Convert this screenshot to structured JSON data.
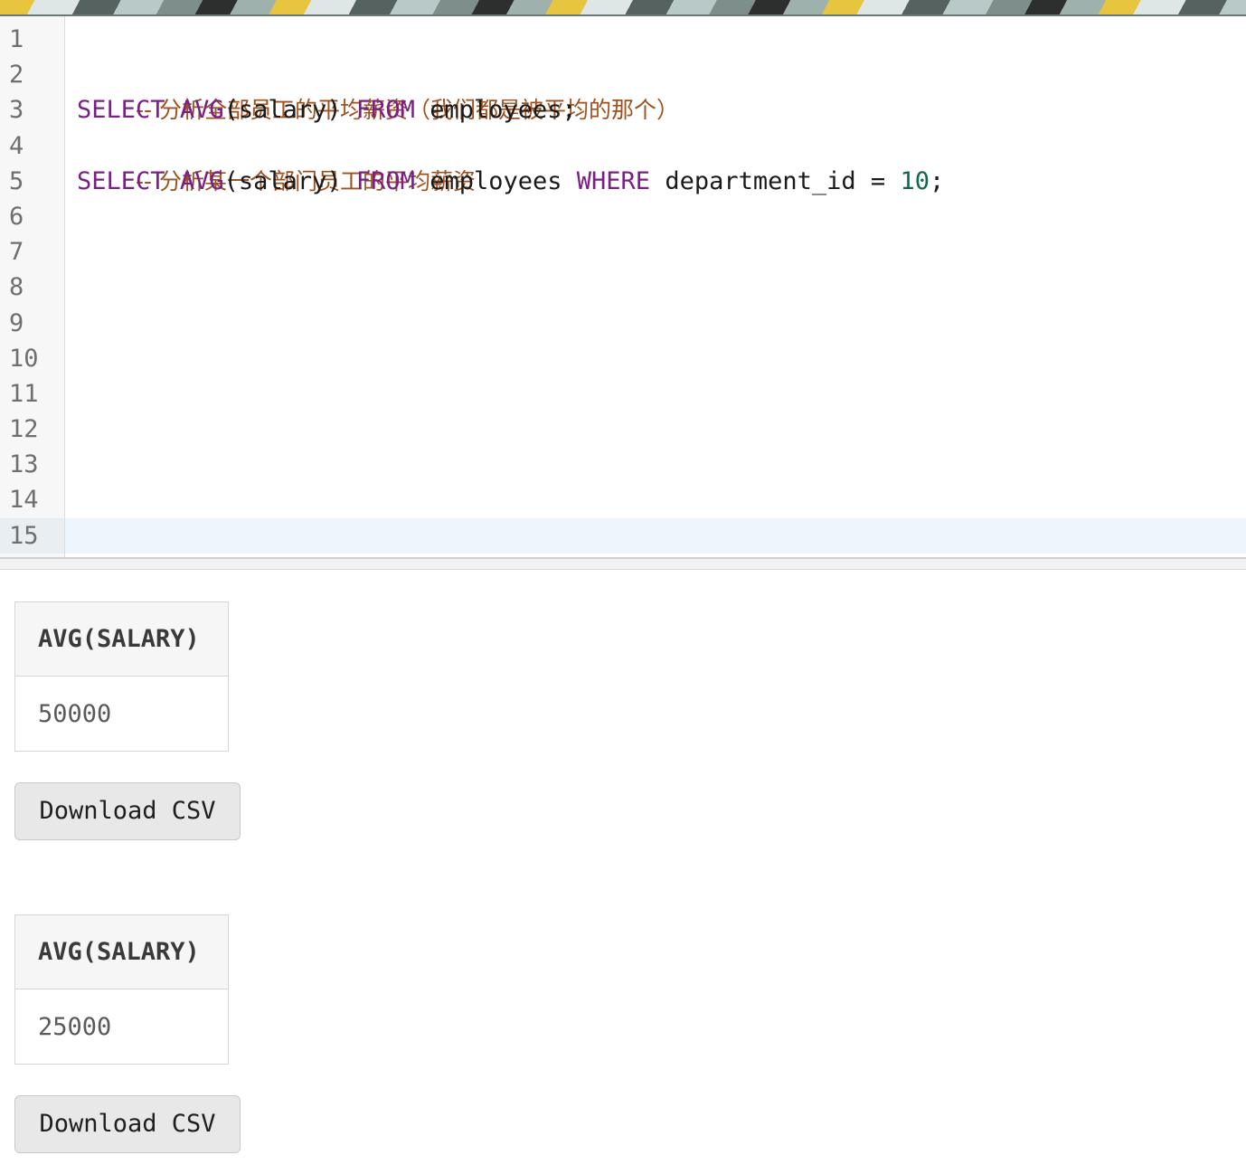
{
  "editor": {
    "line_numbers": [
      "1",
      "2",
      "3",
      "4",
      "5",
      "6",
      "7",
      "8",
      "9",
      "10",
      "11",
      "12",
      "13",
      "14",
      "15"
    ],
    "active_line": "15",
    "lines": {
      "l2": {
        "comment": "-- 分析全部员工的平均薪资（我们都是被平均的那个）"
      },
      "l3": {
        "kw1": "SELECT",
        "fn": "AVG",
        "args": "(salary)",
        "kw2": "FROM",
        "rest": "employees;"
      },
      "l4": {
        "comment": "-- 分析某一个部门员工的平均薪资"
      },
      "l5": {
        "kw1": "SELECT",
        "fn": "AVG",
        "args": "(salary)",
        "kw2": "FROM",
        "table": "employees",
        "kw3": "WHERE",
        "cond": "department_id =",
        "num": "10",
        "end": ";"
      }
    }
  },
  "results": [
    {
      "column_header": "AVG(SALARY)",
      "value": "50000",
      "download_label": "Download CSV"
    },
    {
      "column_header": "AVG(SALARY)",
      "value": "25000",
      "download_label": "Download CSV"
    }
  ],
  "colors": {
    "comment": "#a0521e",
    "keyword": "#7b1e87",
    "number": "#11694a",
    "active_line": "#eef6fd"
  }
}
